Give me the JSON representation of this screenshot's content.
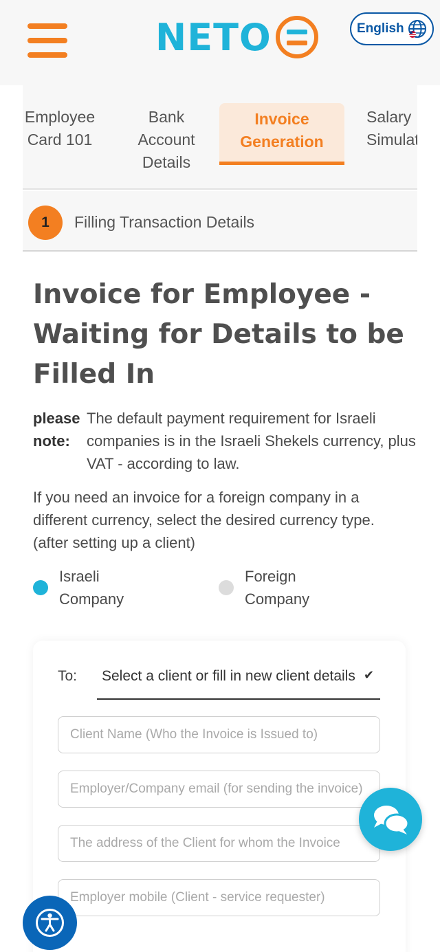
{
  "header": {
    "logo_text": "NETO",
    "language_label": "English",
    "icons": {
      "menu": "hamburger-icon",
      "language": "globe-icon",
      "logo": "neto-equals-icon"
    }
  },
  "tabs": [
    {
      "label": "Employee Card 101",
      "active": false
    },
    {
      "label": "Bank Account Details",
      "active": false
    },
    {
      "label": "Invoice Generation",
      "active": true
    },
    {
      "label": "Salary Simulator",
      "active": false
    }
  ],
  "step": {
    "number": "1",
    "label": "Filling Transaction Details"
  },
  "main": {
    "title": "Invoice for Employee - Waiting for Details to be Filled In",
    "note_label": "please note:",
    "note_text": "The default payment requirement for Israeli companies is in the Israeli Shekels currency, plus VAT - according to law.",
    "info_text": "If you need an invoice for a foreign company in a different currency, select the desired currency type. (after setting up a client)",
    "radios": [
      {
        "label": "Israeli Company",
        "selected": true
      },
      {
        "label": "Foreign Company",
        "selected": false
      }
    ]
  },
  "form": {
    "to_label": "To:",
    "client_select": "Select a client or fill in new client details",
    "placeholders": {
      "client_name": "Client Name (Who the Invoice is Issued to)",
      "employer_email": "Employer/Company email (for sending the invoice)",
      "client_address": "The address of the Client for whom the Invoice",
      "employer_mobile": "Employer mobile (Client - service requester)"
    }
  },
  "floating": {
    "chat_icon": "chat-bubbles-icon",
    "accessibility_icon": "accessibility-icon"
  },
  "colors": {
    "brand_orange": "#f37f21",
    "brand_cyan": "#1fb3d9",
    "brand_blue": "#0a58a5",
    "accessibility_blue": "#0a66b8"
  }
}
